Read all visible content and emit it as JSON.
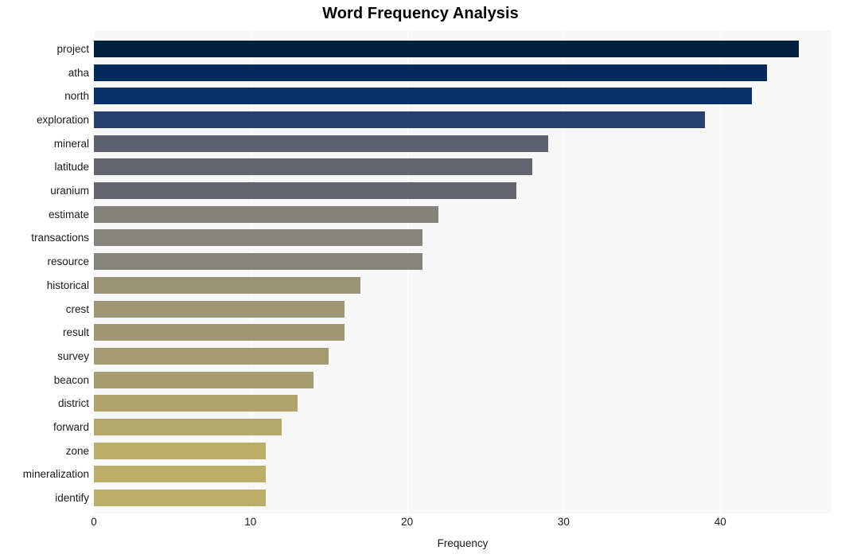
{
  "chart_data": {
    "type": "bar",
    "orientation": "horizontal",
    "title": "Word Frequency Analysis",
    "xlabel": "Frequency",
    "ylabel": "",
    "xlim": [
      0,
      47.1
    ],
    "xticks": [
      0,
      10,
      20,
      30,
      40
    ],
    "xtick_labels": [
      "0",
      "10",
      "20",
      "30",
      "40"
    ],
    "grid": "vertical-only",
    "legend": "none",
    "categories": [
      "project",
      "atha",
      "north",
      "exploration",
      "mineral",
      "latitude",
      "uranium",
      "estimate",
      "transactions",
      "resource",
      "historical",
      "crest",
      "result",
      "survey",
      "beacon",
      "district",
      "forward",
      "zone",
      "mineralization",
      "identify"
    ],
    "values": [
      45,
      43,
      42,
      39,
      29,
      28,
      27,
      22,
      21,
      21,
      17,
      16,
      16,
      15,
      14,
      13,
      12,
      11,
      11,
      11
    ],
    "bar_colors": [
      "#04203f",
      "#042a5c",
      "#08306b",
      "#27406f",
      "#5d6170",
      "#62656f",
      "#62656f",
      "#83817a",
      "#85837b",
      "#85837b",
      "#9a9274",
      "#9e9674",
      "#9e9674",
      "#a59a70",
      "#a89d6f",
      "#b0a46c",
      "#b4a76b",
      "#bcad68",
      "#bcad68",
      "#bcad68"
    ]
  },
  "figure": {
    "background_color": "#ffffff",
    "plot_background_color": "#f7f7f7",
    "gridline_color": "#ffffff",
    "text_color": "#1a1a1a",
    "title_color": "#000000"
  }
}
